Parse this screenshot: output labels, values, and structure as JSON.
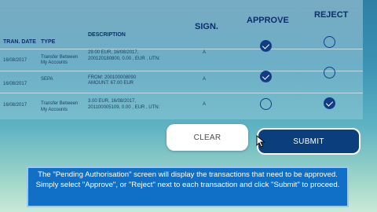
{
  "table": {
    "headers": {
      "tran_date": "TRAN. DATE",
      "type": "TYPE",
      "description": "DESCRIPTION",
      "sign": "SIGN.",
      "approve": "APPROVE",
      "reject": "REJECT"
    },
    "rows": [
      {
        "date": "16/08/2017",
        "type_line1": "Transfer Between",
        "type_line2": "My Accounts",
        "desc_line1": "29.00 EUR, 16/08/2017,",
        "desc_line2": "200120180800, 0.00 , EUR , UTN:",
        "sign": "A",
        "approve": true,
        "reject": false
      },
      {
        "date": "16/08/2017",
        "type_line1": "SEPA",
        "type_line2": "",
        "desc_line1": "FROM: 200100008090",
        "desc_line2": "AMOUNT: 67.00 EUR",
        "sign": "A",
        "approve": true,
        "reject": false
      },
      {
        "date": "16/08/2017",
        "type_line1": "Transfer Between",
        "type_line2": "My Accounts",
        "desc_line1": "3.00 EUR, 16/08/2017,",
        "desc_line2": "201100005109, 0.00 , EUR , UTN:",
        "sign": "A",
        "approve": false,
        "reject": true
      }
    ]
  },
  "buttons": {
    "clear_label": "CLEAR",
    "submit_label": "SUBMIT"
  },
  "caption": {
    "text": "The \"Pending Authorisation\" screen will display the transactions that need to be approved. Simply select \"Approve\", or \"Reject\" next to each transaction and click \"Submit\" to proceed."
  },
  "colors": {
    "accent": "#0a3e7d",
    "header_text": "#0b2e6f",
    "caption_bg": "#1070c8"
  }
}
